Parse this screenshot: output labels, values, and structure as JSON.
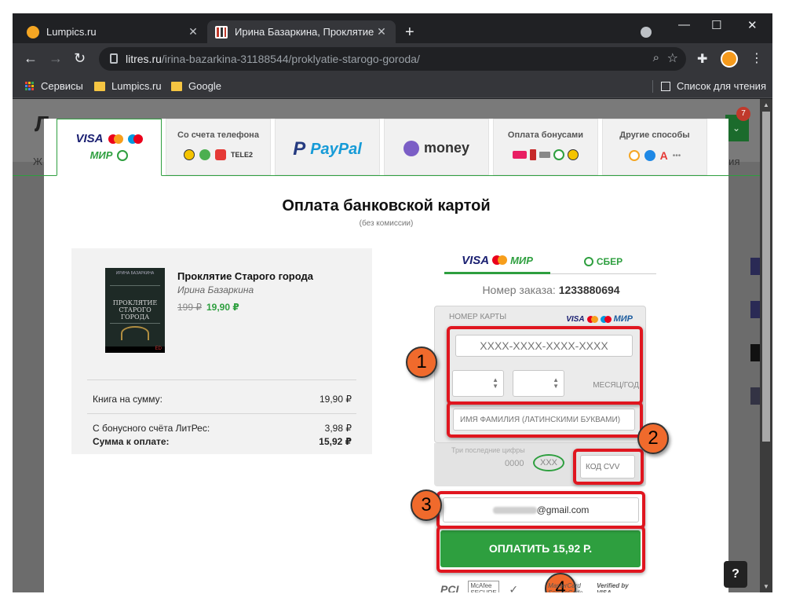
{
  "browser": {
    "tabs": [
      {
        "title": "Lumpics.ru",
        "favicon_color": "#f5a623"
      },
      {
        "title": "Ирина Базаркина, Проклятие С",
        "favicon_color": "#c0392b"
      }
    ],
    "new_tab": "+",
    "close": "✕",
    "window_controls": [
      "—",
      "☐",
      "✕"
    ],
    "url_domain": "litres.ru",
    "url_path": "/irina-bazarkina-31188544/proklyatie-starogo-goroda/",
    "bookmarks": [
      {
        "label": "Сервисы"
      },
      {
        "label": "Lumpics.ru"
      },
      {
        "label": "Google"
      }
    ],
    "reading_list": "Список для чтения"
  },
  "background_page": {
    "logo_letter": "Л",
    "nav_left": "Ж",
    "nav_right": "ния",
    "cart_badge": "7"
  },
  "payment_tabs": {
    "phone": "Со счета телефона",
    "phone_operator": "TELE2",
    "paypal": "PayPal",
    "money": "money",
    "bonus": "Оплата бонусами",
    "other": "Другие способы",
    "card_visa": "VISA",
    "card_mir": "МИР",
    "ellipsis": "•••"
  },
  "modal": {
    "title": "Оплата банковской картой",
    "subtitle": "(без комиссии)"
  },
  "book": {
    "title": "Проклятие Старого города",
    "author": "Ирина Базаркина",
    "old_price": "199 ₽",
    "new_price": "19,90 ₽",
    "cover_author": "ИРИНА БАЗАРКИНА",
    "cover_title": "ПРОКЛЯТИЕ СТАРОГО ГОРОДА",
    "cover_brand": "ED"
  },
  "summary": [
    {
      "label": "Книга на сумму:",
      "value": "19,90 ₽"
    },
    {
      "label": "С бонусного счёта ЛитРес:",
      "value": "3,98 ₽"
    },
    {
      "label": "Сумма к оплате:",
      "value": "15,92 ₽"
    }
  ],
  "card_tabs": {
    "visa": "VISA",
    "mir": "МИР",
    "sber": "СБЕР"
  },
  "order": {
    "label": "Номер заказа:",
    "number": "1233880694"
  },
  "card_form": {
    "number_label": "НОМЕР КАРТЫ",
    "number_placeholder": "XXXX-XXXX-XXXX-XXXX",
    "month_year_label": "МЕСЯЦ/ГОД",
    "name_placeholder": "ИМЯ ФАМИЛИЯ (ЛАТИНСКИМИ БУКВАМИ)",
    "last_digits_label": "Три последние цифры",
    "cvv_sample_prefix": "0000",
    "cvv_sample": "XXX",
    "cvv_placeholder": "КОД CVV",
    "email_value": "@gmail.com",
    "pay_button": "ОПЛАТИТЬ 15,92 Р."
  },
  "steps": [
    "1",
    "2",
    "3",
    "4"
  ],
  "seals": [
    "PCI",
    "McAfee SECURE",
    "MasterCard SecureCode",
    "Verified by VISA"
  ],
  "help": "?",
  "colors": {
    "accent_green": "#2e9f3f",
    "highlight_red": "#e0161f",
    "step_orange": "#f06a2c"
  }
}
